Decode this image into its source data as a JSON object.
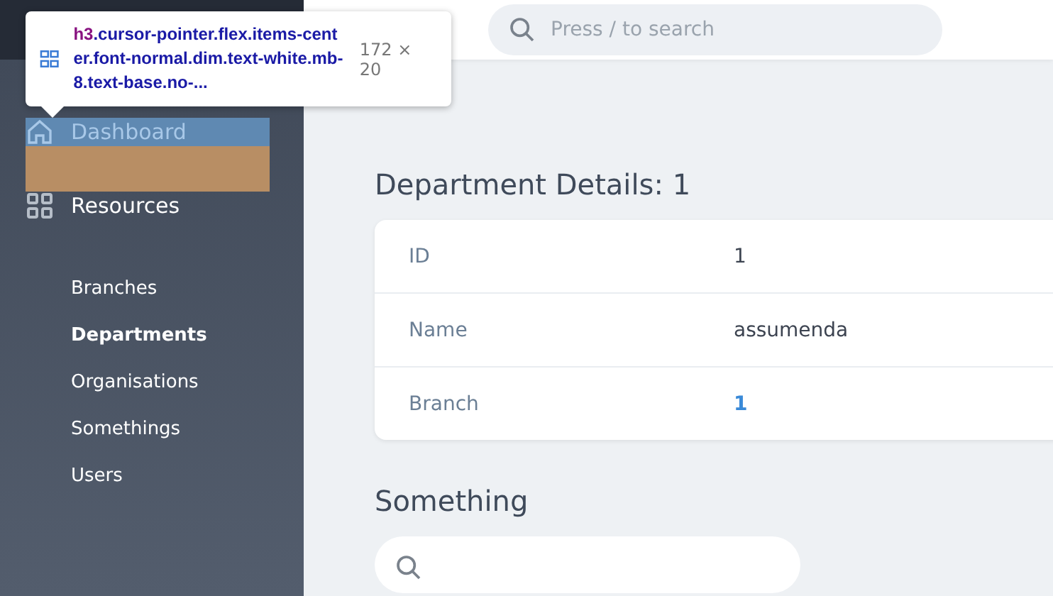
{
  "search": {
    "placeholder": "Press / to search"
  },
  "sidebar": {
    "items": [
      {
        "label": "Dashboard",
        "kind": "link",
        "highlighted": true
      },
      {
        "label": "Resources",
        "kind": "group",
        "highlighted": false,
        "children": [
          {
            "label": "Branches",
            "selected": false
          },
          {
            "label": "Departments",
            "selected": true
          },
          {
            "label": "Organisations",
            "selected": false
          },
          {
            "label": "Somethings",
            "selected": false
          },
          {
            "label": "Users",
            "selected": false
          }
        ]
      }
    ]
  },
  "inspector_tooltip": {
    "tag": "h3",
    "selector": ".cursor-pointer.flex.items-center.font-normal.dim.text-white.mb-8.text-base.no-...",
    "size": "172 × 20"
  },
  "detail": {
    "title": "Department Details: 1",
    "fields": [
      {
        "label": "ID",
        "value": "1",
        "kind": "text"
      },
      {
        "label": "Name",
        "value": "assumenda",
        "kind": "text"
      },
      {
        "label": "Branch",
        "value": "1",
        "kind": "link"
      }
    ]
  },
  "related": {
    "title": "Something"
  }
}
